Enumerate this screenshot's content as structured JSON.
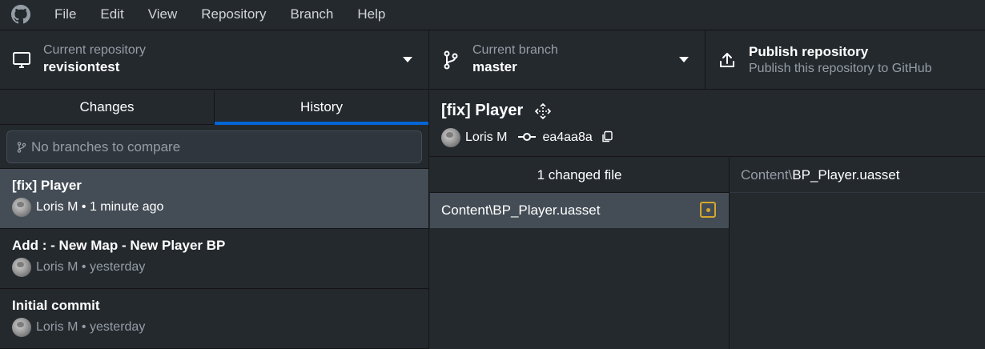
{
  "menubar": {
    "items": [
      "File",
      "Edit",
      "View",
      "Repository",
      "Branch",
      "Help"
    ]
  },
  "toolbar": {
    "repo": {
      "label": "Current repository",
      "value": "revisiontest"
    },
    "branch": {
      "label": "Current branch",
      "value": "master"
    },
    "publish": {
      "label": "Publish repository",
      "description": "Publish this repository to GitHub"
    }
  },
  "sidebar": {
    "tabs": [
      "Changes",
      "History"
    ],
    "active_tab": "History",
    "compare_placeholder": "No branches to compare",
    "commits": [
      {
        "title": "[fix] Player",
        "meta": "Loris M • 1 minute ago",
        "selected": true
      },
      {
        "title": "Add : - New Map - New Player BP",
        "meta": "Loris M • yesterday",
        "selected": false
      },
      {
        "title": "Initial commit",
        "meta": "Loris M • yesterday",
        "selected": false
      }
    ]
  },
  "commit_detail": {
    "title": "[fix] Player",
    "author": "Loris M",
    "sha": "ea4aa8a",
    "changed_files_label": "1 changed file",
    "files": [
      {
        "path": "Content\\BP_Player.uasset",
        "status": "modified"
      }
    ]
  },
  "diff": {
    "dir": "Content\\",
    "filename": "BP_Player.uasset"
  },
  "colors": {
    "background": "#24292e",
    "selected": "#444d56",
    "accent": "#0366d6",
    "modified": "#d4a72c"
  }
}
